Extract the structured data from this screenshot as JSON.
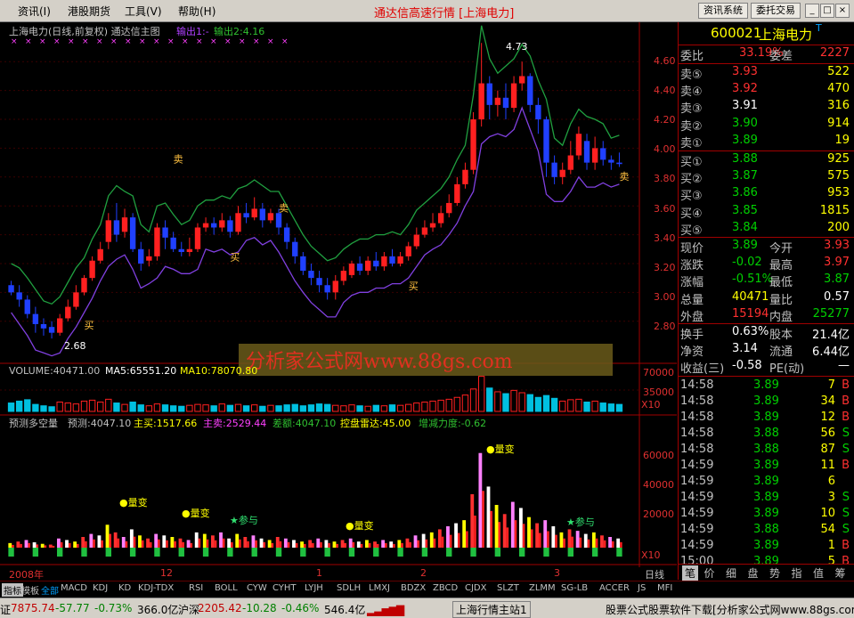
{
  "menu": [
    "资讯(I)",
    "港股期货",
    "工具(V)",
    "帮助(H)"
  ],
  "window_title": "通达信高速行情 [上海电力]",
  "sys_buttons": [
    "资讯系统",
    "委托交易"
  ],
  "chart_title": "上海电力(日线,前复权) 通达信主图",
  "chart_out1": "输出1:-",
  "chart_out2": "输出2:4.16",
  "price_axis": [
    "4.60",
    "4.40",
    "4.20",
    "4.00",
    "3.80",
    "3.60",
    "3.40",
    "3.20",
    "3.00",
    "2.80"
  ],
  "high_label": "4.73",
  "low_label": "2.68",
  "watermark": "分析家公式网www.88gs.com",
  "sell_tag": "卖",
  "buy_tag": "买",
  "volume_title": "VOLUME:40471.00",
  "ma5": "MA5:65551.20",
  "ma10": "MA10:78070.80",
  "vol_axis": [
    "70000",
    "35000"
  ],
  "x10": "X10",
  "ind_title": "预测多空量",
  "ind_pred": "预测:4047.10",
  "ind_buy": "主买:1517.66",
  "ind_sell": "主卖:2529.44",
  "ind_diff": "差额:4047.10",
  "ind_radar": "控盘雷达:45.00",
  "ind_delta": "增减力度:-0.62",
  "ind_axis": [
    "60000",
    "40000",
    "20000"
  ],
  "liangbian": "量变",
  "canyu": "参与",
  "dates": [
    "2008年",
    "12",
    "1",
    "2",
    "3"
  ],
  "period_label": "日线",
  "quote": {
    "code": "600021",
    "name": "上海电力",
    "suffix": "T",
    "weibi_label": "委比",
    "weibi": "33.19%",
    "weicha_label": "委差",
    "weicha": "2227",
    "sells": [
      {
        "label": "卖⑤",
        "price": "3.93",
        "vol": "522",
        "color": "#ff3030"
      },
      {
        "label": "卖④",
        "price": "3.92",
        "vol": "470",
        "color": "#ff3030"
      },
      {
        "label": "卖③",
        "price": "3.91",
        "vol": "316",
        "color": "#ffffff"
      },
      {
        "label": "卖②",
        "price": "3.90",
        "vol": "914",
        "color": "#00d000"
      },
      {
        "label": "卖①",
        "price": "3.89",
        "vol": "19",
        "color": "#00d000"
      }
    ],
    "buys": [
      {
        "label": "买①",
        "price": "3.88",
        "vol": "925",
        "color": "#00d000"
      },
      {
        "label": "买②",
        "price": "3.87",
        "vol": "575",
        "color": "#00d000"
      },
      {
        "label": "买③",
        "price": "3.86",
        "vol": "953",
        "color": "#00d000"
      },
      {
        "label": "买④",
        "price": "3.85",
        "vol": "1815",
        "color": "#00d000"
      },
      {
        "label": "买⑤",
        "price": "3.84",
        "vol": "200",
        "color": "#00d000"
      }
    ],
    "stats": [
      {
        "l1": "现价",
        "v1": "3.89",
        "c1": "#00d000",
        "l2": "今开",
        "v2": "3.93",
        "c2": "#ff3030"
      },
      {
        "l1": "涨跌",
        "v1": "-0.02",
        "c1": "#00d000",
        "l2": "最高",
        "v2": "3.97",
        "c2": "#ff3030"
      },
      {
        "l1": "涨幅",
        "v1": "-0.51%",
        "c1": "#00d000",
        "l2": "最低",
        "v2": "3.87",
        "c2": "#00d000"
      },
      {
        "l1": "总量",
        "v1": "40471",
        "c1": "#ffff00",
        "l2": "量比",
        "v2": "0.57",
        "c2": "#ffffff"
      },
      {
        "l1": "外盘",
        "v1": "15194",
        "c1": "#ff3030",
        "l2": "内盘",
        "v2": "25277",
        "c2": "#00d000"
      }
    ],
    "stats2": [
      {
        "l1": "换手",
        "v1": "0.63%",
        "l2": "股本",
        "v2": "21.4亿"
      },
      {
        "l1": "净资",
        "v1": "3.14",
        "l2": "流通",
        "v2": "6.44亿"
      },
      {
        "l1": "收益(三)",
        "v1": "-0.58",
        "l2": "PE(动)",
        "v2": "—"
      }
    ],
    "ticks": [
      {
        "t": "14:58",
        "p": "3.89",
        "v": "7",
        "s": "B"
      },
      {
        "t": "14:58",
        "p": "3.89",
        "v": "34",
        "s": "B"
      },
      {
        "t": "14:58",
        "p": "3.89",
        "v": "12",
        "s": "B"
      },
      {
        "t": "14:58",
        "p": "3.88",
        "v": "56",
        "s": "S"
      },
      {
        "t": "14:58",
        "p": "3.88",
        "v": "87",
        "s": "S"
      },
      {
        "t": "14:59",
        "p": "3.89",
        "v": "11",
        "s": "B"
      },
      {
        "t": "14:59",
        "p": "3.89",
        "v": "6",
        "s": ""
      },
      {
        "t": "14:59",
        "p": "3.89",
        "v": "3",
        "s": "S"
      },
      {
        "t": "14:59",
        "p": "3.89",
        "v": "10",
        "s": "S"
      },
      {
        "t": "14:59",
        "p": "3.88",
        "v": "54",
        "s": "S"
      },
      {
        "t": "14:59",
        "p": "3.89",
        "v": "1",
        "s": "B"
      },
      {
        "t": "15:00",
        "p": "3.89",
        "v": "5",
        "s": "B"
      }
    ],
    "side_tabs": [
      "笔",
      "价",
      "细",
      "盘",
      "势",
      "指",
      "值",
      "筹"
    ]
  },
  "tabs": [
    "指标",
    "模板",
    "全部",
    "MACD",
    "KDJ",
    "KD",
    "KDJ-TDX",
    "RSI",
    "BOLL",
    "CYW",
    "CYHT",
    "LYJH",
    "SDLH",
    "LMXJ",
    "BDZX",
    "ZBCD",
    "CJDX",
    "SLZT",
    "ZLMM",
    "SG-LB",
    "ACCER",
    "JS",
    "MFI"
  ],
  "status": {
    "sh_label": "证",
    "sh_index": "7875.74",
    "sh_chg": "-57.77",
    "sh_pct": "-0.73%",
    "sh_amt": "366.0亿",
    "sz_label": "沪深",
    "sz_index": "2205.42",
    "sz_chg": "-10.28",
    "sz_pct": "-0.46%",
    "sz_amt": "546.4亿",
    "server": "上海行情主站1",
    "ad": "股票公式股票软件下载[分析家公式网www.88gs.com]"
  },
  "chart_data": {
    "type": "candlestick",
    "y_range": [
      2.65,
      4.75
    ],
    "candles": [
      [
        3.05,
        3.0,
        3.08,
        2.98
      ],
      [
        3.0,
        2.95,
        3.05,
        2.9
      ],
      [
        2.95,
        2.85,
        2.98,
        2.82
      ],
      [
        2.85,
        2.78,
        2.9,
        2.72
      ],
      [
        2.78,
        2.75,
        2.82,
        2.7
      ],
      [
        2.76,
        2.72,
        2.8,
        2.68
      ],
      [
        2.72,
        2.82,
        2.85,
        2.7
      ],
      [
        2.82,
        2.9,
        2.95,
        2.8
      ],
      [
        2.9,
        3.0,
        3.05,
        2.88
      ],
      [
        3.0,
        3.1,
        3.12,
        2.98
      ],
      [
        3.1,
        3.22,
        3.25,
        3.08
      ],
      [
        3.22,
        3.3,
        3.35,
        3.2
      ],
      [
        3.35,
        3.5,
        3.55,
        3.3
      ],
      [
        3.5,
        3.4,
        3.62,
        3.35
      ],
      [
        3.42,
        3.52,
        3.58,
        3.38
      ],
      [
        3.52,
        3.3,
        3.55,
        3.28
      ],
      [
        3.3,
        3.2,
        3.35,
        3.15
      ],
      [
        3.22,
        3.25,
        3.3,
        3.18
      ],
      [
        3.25,
        3.45,
        3.48,
        3.22
      ],
      [
        3.45,
        3.38,
        3.5,
        3.3
      ],
      [
        3.38,
        3.3,
        3.42,
        3.28
      ],
      [
        3.3,
        3.28,
        3.35,
        3.25
      ],
      [
        3.28,
        3.3,
        3.38,
        3.25
      ],
      [
        3.3,
        3.45,
        3.48,
        3.28
      ],
      [
        3.45,
        3.48,
        3.52,
        3.42
      ],
      [
        3.48,
        3.45,
        3.52,
        3.4
      ],
      [
        3.45,
        3.5,
        3.55,
        3.42
      ],
      [
        3.5,
        3.42,
        3.53,
        3.38
      ],
      [
        3.42,
        3.55,
        3.6,
        3.4
      ],
      [
        3.55,
        3.52,
        3.62,
        3.48
      ],
      [
        3.52,
        3.58,
        3.66,
        3.5
      ],
      [
        3.58,
        3.5,
        3.62,
        3.45
      ],
      [
        3.5,
        3.55,
        3.58,
        3.48
      ],
      [
        3.55,
        3.45,
        3.58,
        3.4
      ],
      [
        3.45,
        3.35,
        3.48,
        3.3
      ],
      [
        3.35,
        3.25,
        3.38,
        3.2
      ],
      [
        3.25,
        3.15,
        3.28,
        3.12
      ],
      [
        3.15,
        3.1,
        3.2,
        3.05
      ],
      [
        3.1,
        3.05,
        3.15,
        3.0
      ],
      [
        3.05,
        3.0,
        3.1,
        2.95
      ],
      [
        3.0,
        3.08,
        3.12,
        2.95
      ],
      [
        3.08,
        3.15,
        3.18,
        3.05
      ],
      [
        3.12,
        3.2,
        3.22,
        3.1
      ],
      [
        3.2,
        3.15,
        3.25,
        3.12
      ],
      [
        3.15,
        3.22,
        3.25,
        3.12
      ],
      [
        3.22,
        3.18,
        3.28,
        3.15
      ],
      [
        3.18,
        3.25,
        3.28,
        3.15
      ],
      [
        3.25,
        3.2,
        3.3,
        3.18
      ],
      [
        3.2,
        3.25,
        3.28,
        3.18
      ],
      [
        3.25,
        3.32,
        3.35,
        3.22
      ],
      [
        3.32,
        3.4,
        3.45,
        3.3
      ],
      [
        3.4,
        3.45,
        3.5,
        3.38
      ],
      [
        3.45,
        3.48,
        3.55,
        3.42
      ],
      [
        3.48,
        3.55,
        3.6,
        3.45
      ],
      [
        3.55,
        3.62,
        3.68,
        3.52
      ],
      [
        3.62,
        3.75,
        3.8,
        3.6
      ],
      [
        3.75,
        3.85,
        3.9,
        3.72
      ],
      [
        3.85,
        4.2,
        4.25,
        3.82
      ],
      [
        4.2,
        4.45,
        4.73,
        4.15
      ],
      [
        4.45,
        4.3,
        4.5,
        4.2
      ],
      [
        4.3,
        4.35,
        4.4,
        4.22
      ],
      [
        4.35,
        4.28,
        4.45,
        4.2
      ],
      [
        4.28,
        4.45,
        4.5,
        4.25
      ],
      [
        4.45,
        4.5,
        4.6,
        4.4
      ],
      [
        4.5,
        4.3,
        4.52,
        4.25
      ],
      [
        4.3,
        4.2,
        4.35,
        4.1
      ],
      [
        4.2,
        3.9,
        4.22,
        3.8
      ],
      [
        3.9,
        3.8,
        3.95,
        3.75
      ],
      [
        3.8,
        3.85,
        3.9,
        3.75
      ],
      [
        3.85,
        3.95,
        4.05,
        3.82
      ],
      [
        3.95,
        4.1,
        4.15,
        3.92
      ],
      [
        4.05,
        3.9,
        4.1,
        3.85
      ],
      [
        3.9,
        4.0,
        4.08,
        3.85
      ],
      [
        4.0,
        3.92,
        4.05,
        3.88
      ],
      [
        3.92,
        3.9,
        3.95,
        3.85
      ],
      [
        3.9,
        3.89,
        3.97,
        3.87
      ]
    ],
    "volume_max": 80000,
    "volumes": [
      18000,
      22000,
      25000,
      15000,
      12000,
      10000,
      20000,
      18000,
      16000,
      22000,
      24000,
      20000,
      26000,
      18000,
      15000,
      20000,
      14000,
      12000,
      16000,
      14000,
      12000,
      11000,
      13000,
      15000,
      14000,
      12000,
      16000,
      13000,
      15000,
      12000,
      14000,
      11000,
      13000,
      12000,
      14000,
      15000,
      12000,
      14000,
      16000,
      15000,
      13000,
      12000,
      14000,
      12000,
      11000,
      13000,
      12000,
      14000,
      13000,
      15000,
      18000,
      20000,
      22000,
      24000,
      26000,
      30000,
      35000,
      48000,
      75000,
      50000,
      42000,
      38000,
      45000,
      40000,
      36000,
      30000,
      34000,
      28000,
      22000,
      25000,
      26000,
      20000,
      22000,
      18000,
      16000,
      15000
    ],
    "ind_max": 70000,
    "ind_values": [
      3000,
      4000,
      5000,
      3500,
      2500,
      2000,
      6000,
      5000,
      4000,
      7000,
      9000,
      8000,
      15000,
      10000,
      7000,
      12000,
      8000,
      6000,
      9000,
      8000,
      7000,
      6000,
      5000,
      10000,
      9000,
      8000,
      10000,
      6000,
      9000,
      7000,
      8000,
      6000,
      5000,
      7000,
      6000,
      5000,
      4000,
      5000,
      6000,
      5000,
      4000,
      5000,
      6000,
      4000,
      5000,
      4000,
      5000,
      4000,
      5000,
      6000,
      8000,
      9000,
      10000,
      12000,
      14000,
      16000,
      18000,
      35000,
      62000,
      40000,
      28000,
      22000,
      30000,
      26000,
      20000,
      16000,
      18000,
      14000,
      10000,
      12000,
      11000,
      9000,
      10000,
      8000,
      7000,
      6000
    ]
  }
}
